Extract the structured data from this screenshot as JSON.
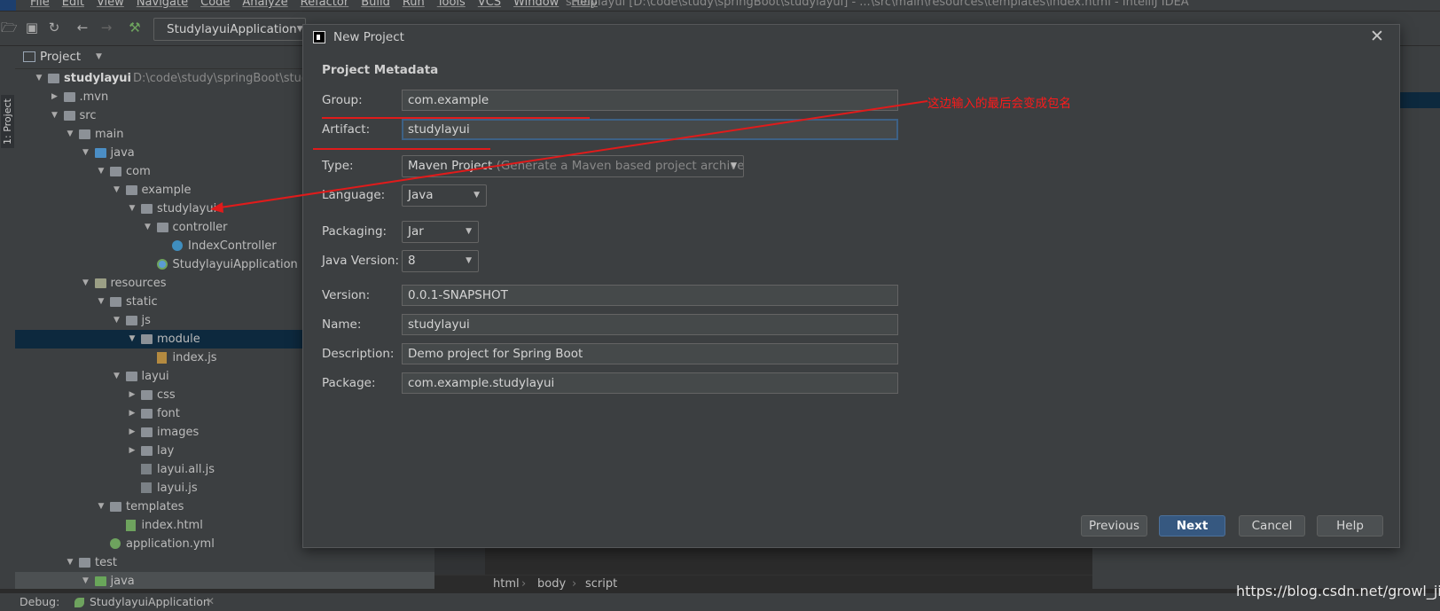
{
  "menubar": {
    "items": [
      "File",
      "Edit",
      "View",
      "Navigate",
      "Code",
      "Analyze",
      "Refactor",
      "Build",
      "Run",
      "Tools",
      "VCS",
      "Window",
      "Help"
    ],
    "window_title": "studylayui [D:\\code\\study\\springBoot\\studylayui] - ...\\src\\main\\resources\\templates\\index.html - IntelliJ IDEA"
  },
  "toolbar": {
    "run_config": "StudylayuiApplication"
  },
  "side_tab": "1: Project",
  "project_panel": {
    "title": "Project",
    "tree": [
      {
        "label": "studylayui",
        "path": "D:\\code\\study\\springBoot\\studylayui",
        "level": 0,
        "arrow": "down",
        "icon": "folder",
        "bold": true
      },
      {
        "label": ".mvn",
        "level": 1,
        "arrow": "right",
        "icon": "folder"
      },
      {
        "label": "src",
        "level": 1,
        "arrow": "down",
        "icon": "folder"
      },
      {
        "label": "main",
        "level": 2,
        "arrow": "down",
        "icon": "folder"
      },
      {
        "label": "java",
        "level": 3,
        "arrow": "down",
        "icon": "folder-blue"
      },
      {
        "label": "com",
        "level": 4,
        "arrow": "down",
        "icon": "folder"
      },
      {
        "label": "example",
        "level": 5,
        "arrow": "down",
        "icon": "folder"
      },
      {
        "label": "studylayui",
        "level": 6,
        "arrow": "down",
        "icon": "folder"
      },
      {
        "label": "controller",
        "level": 7,
        "arrow": "down",
        "icon": "folder"
      },
      {
        "label": "IndexController",
        "level": 8,
        "arrow": "none",
        "icon": "class"
      },
      {
        "label": "StudylayuiApplication",
        "level": 7,
        "arrow": "none",
        "icon": "springapp"
      },
      {
        "label": "resources",
        "level": 3,
        "arrow": "down",
        "icon": "folder-res"
      },
      {
        "label": "static",
        "level": 4,
        "arrow": "down",
        "icon": "folder"
      },
      {
        "label": "js",
        "level": 5,
        "arrow": "down",
        "icon": "folder"
      },
      {
        "label": "module",
        "level": 6,
        "arrow": "down",
        "icon": "folder",
        "selected": true
      },
      {
        "label": "index.js",
        "level": 7,
        "arrow": "none",
        "icon": "jsfile"
      },
      {
        "label": "layui",
        "level": 5,
        "arrow": "down",
        "icon": "folder"
      },
      {
        "label": "css",
        "level": 6,
        "arrow": "right",
        "icon": "folder"
      },
      {
        "label": "font",
        "level": 6,
        "arrow": "right",
        "icon": "folder"
      },
      {
        "label": "images",
        "level": 6,
        "arrow": "right",
        "icon": "folder"
      },
      {
        "label": "lay",
        "level": 6,
        "arrow": "right",
        "icon": "folder"
      },
      {
        "label": "layui.all.js",
        "level": 6,
        "arrow": "none",
        "icon": "binfile"
      },
      {
        "label": "layui.js",
        "level": 6,
        "arrow": "none",
        "icon": "binfile"
      },
      {
        "label": "templates",
        "level": 4,
        "arrow": "down",
        "icon": "folder"
      },
      {
        "label": "index.html",
        "level": 5,
        "arrow": "none",
        "icon": "htmlfile"
      },
      {
        "label": "application.yml",
        "level": 4,
        "arrow": "none",
        "icon": "ymlfile"
      },
      {
        "label": "test",
        "level": 2,
        "arrow": "down",
        "icon": "folder"
      },
      {
        "label": "java",
        "level": 3,
        "arrow": "down",
        "icon": "folder-green",
        "highlight": true
      }
    ]
  },
  "breadcrumbs": [
    "html",
    "body",
    "script"
  ],
  "statusbar": {
    "debug_label": "Debug:",
    "debug_app": "StudylayuiApplication"
  },
  "dialog": {
    "title": "New Project",
    "section": "Project Metadata",
    "fields": {
      "group": {
        "label": "Group:",
        "value": "com.example"
      },
      "artifact": {
        "label": "Artifact:",
        "value": "studylayui"
      },
      "type": {
        "label": "Type:",
        "value": "Maven Project",
        "hint": "(Generate a Maven based project archive.)"
      },
      "language": {
        "label": "Language:",
        "value": "Java"
      },
      "packaging": {
        "label": "Packaging:",
        "value": "Jar"
      },
      "java_version": {
        "label": "Java Version:",
        "value": "8"
      },
      "version": {
        "label": "Version:",
        "value": "0.0.1-SNAPSHOT"
      },
      "name": {
        "label": "Name:",
        "value": "studylayui"
      },
      "description": {
        "label": "Description:",
        "value": "Demo project for Spring Boot"
      },
      "package": {
        "label": "Package:",
        "value": "com.example.studylayui"
      }
    },
    "buttons": {
      "previous": "Previous",
      "next": "Next",
      "cancel": "Cancel",
      "help": "Help"
    }
  },
  "annotation": {
    "text": "这边输入的最后会变成包名",
    "color": "#ff1a1a"
  },
  "watermark": "https://blog.csdn.net/growl_jie_"
}
